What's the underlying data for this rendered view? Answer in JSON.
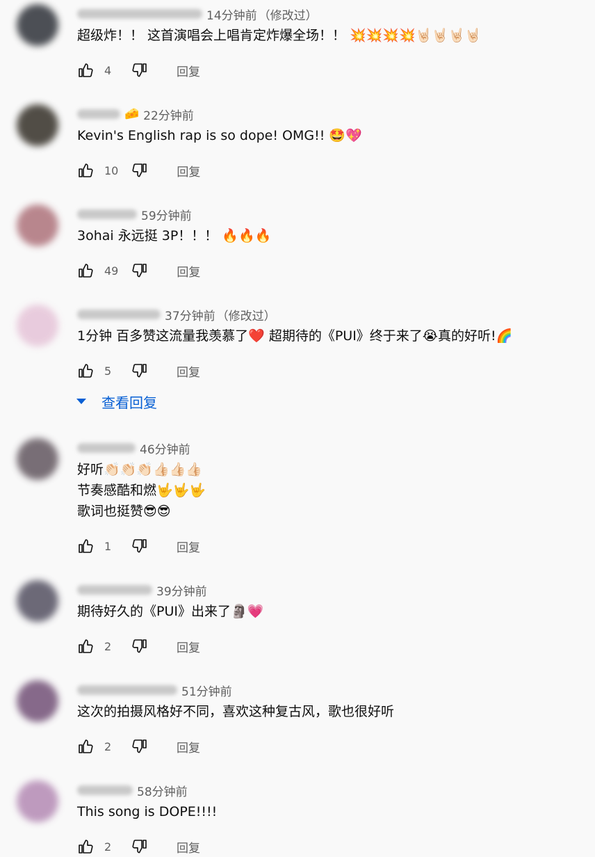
{
  "colors": {
    "background": "#f9f9f9",
    "text": "#0f0f0f",
    "secondary": "#606060",
    "link": "#065fd4"
  },
  "labels": {
    "reply": "回复",
    "view_replies": "查看回复"
  },
  "comments": [
    {
      "badge": "",
      "time": "14分钟前",
      "edited": "（修改过）",
      "text": "超级炸！！ 这首演唱会上唱肯定炸爆全场！！ 💥💥💥💥🤘🏻🤘🏻🤘🏻🤘🏻",
      "likes": "4",
      "avatar_color": "#3a3d44"
    },
    {
      "badge": "🧀",
      "time": "22分钟前",
      "edited": "",
      "text": "Kevin's English rap is so dope! OMG!! 🤩💖",
      "likes": "10",
      "avatar_color": "#3f3b33"
    },
    {
      "badge": "",
      "time": "59分钟前",
      "edited": "",
      "text": "3ohai 永远挺 3P！！！ 🔥🔥🔥",
      "likes": "49",
      "avatar_color": "#b27a82"
    },
    {
      "badge": "",
      "time": "37分钟前",
      "edited": "（修改过）",
      "text": "1分钟 百多赞这流量我羡慕了❤️ 超期待的《PUI》终于来了😭真的好听!🌈",
      "likes": "5",
      "avatar_color": "#e7c7da"
    },
    {
      "badge": "",
      "time": "46分钟前",
      "edited": "",
      "text": "好听👏🏻👏🏻👏🏻👍🏻👍🏻👍🏻\n节奏感酷和燃🤟🤟🤟\n歌词也挺赞😎😎",
      "likes": "1",
      "avatar_color": "#6b6068"
    },
    {
      "badge": "",
      "time": "39分钟前",
      "edited": "",
      "text": "期待好久的《PUI》出来了🗿💗",
      "likes": "2",
      "avatar_color": "#5d5a6a"
    },
    {
      "badge": "",
      "time": "51分钟前",
      "edited": "",
      "text": "这次的拍摄风格好不同，喜欢这种复古风，歌也很好听",
      "likes": "2",
      "avatar_color": "#7a5a7e"
    },
    {
      "badge": "",
      "time": "58分钟前",
      "edited": "",
      "text": "This song is DOPE!!!!",
      "likes": "2",
      "avatar_color": "#b890b8"
    }
  ]
}
